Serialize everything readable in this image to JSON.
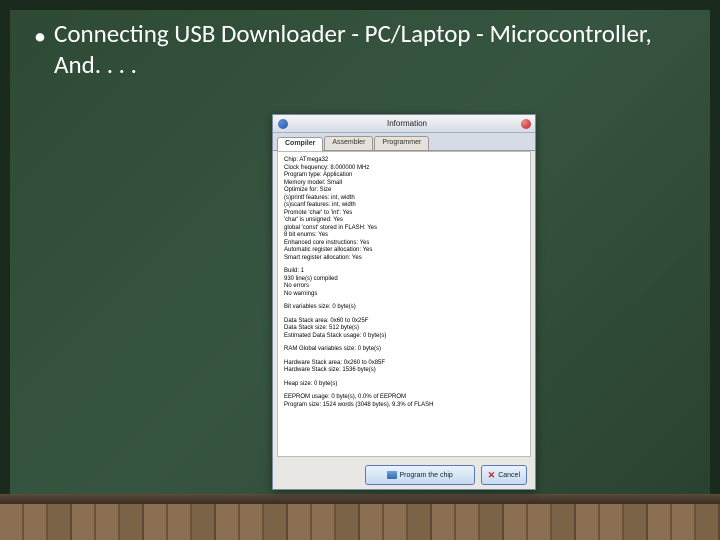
{
  "slide": {
    "bullet": "•",
    "title": "Connecting USB Downloader - PC/Laptop - Microcontroller, And. . . ."
  },
  "dialog": {
    "title": "Information",
    "tabs": [
      "Compiler",
      "Assembler",
      "Programmer"
    ],
    "lines_block1": [
      "Chip: ATmega32",
      "Clock frequency: 8.000000 MHz",
      "Program type: Application",
      "Memory model: Small",
      "Optimize for: Size",
      "(s)printf features: int, width",
      "(s)scanf features: int, width",
      "Promote 'char' to 'int': Yes",
      "'char' is unsigned: Yes",
      "global 'const' stored in FLASH: Yes",
      "8 bit enums: Yes",
      "Enhanced core instructions: Yes",
      "Automatic register allocation: Yes",
      "Smart register allocation: Yes"
    ],
    "lines_block2": [
      "Build: 1",
      "930 line(s) compiled",
      "No errors",
      "No warnings"
    ],
    "lines_block3": [
      "Bit variables size: 0 byte(s)"
    ],
    "lines_block4": [
      "Data Stack area: 0x60 to 0x25F",
      "Data Stack size: 512 byte(s)",
      "Estimated Data Stack usage: 0 byte(s)"
    ],
    "lines_block5": [
      "RAM Global variables size: 0 byte(s)"
    ],
    "lines_block6": [
      "Hardware Stack area: 0x260 to 0x85F",
      "Hardware Stack size: 1536 byte(s)"
    ],
    "lines_block7": [
      "Heap size: 0 byte(s)"
    ],
    "lines_block8": [
      "EEPROM usage: 0 byte(s), 0.0% of EEPROM",
      "Program size: 1524 words (3048 bytes), 9.3% of FLASH"
    ],
    "program_btn": "Program the chip",
    "cancel_btn": "Cancel"
  }
}
